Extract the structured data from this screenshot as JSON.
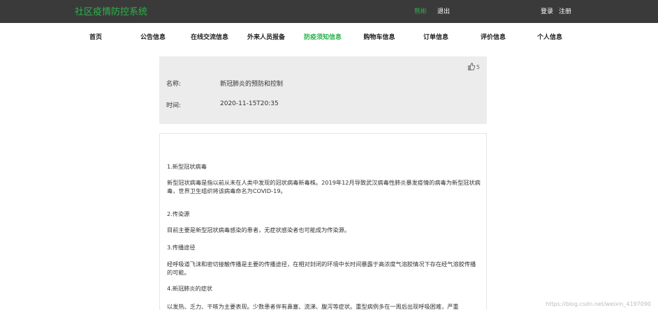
{
  "header": {
    "brand": "社区疫情防控系统",
    "links": [
      "熊彬",
      "退出",
      "登录",
      "注册"
    ]
  },
  "nav": {
    "items": [
      "首页",
      "公告信息",
      "在线交流信息",
      "外来人员报备",
      "防疫须知信息",
      "购物车信息",
      "订单信息",
      "评价信息",
      "个人信息"
    ],
    "active_index": 4
  },
  "detail": {
    "like_count": "5",
    "name_label": "名称:",
    "name_value": "新冠肺炎的预防和控制",
    "time_label": "时间:",
    "time_value": "2020-11-15T20:35"
  },
  "content": {
    "paragraphs": [
      "1.新型冠状病毒",
      "新型冠状病毒是指以前从未在人类中发现的冠状病毒新毒株。2019年12月导致武汉病毒性肺炎暴发疫情的病毒为新型冠状病毒，世界卫生组织将该病毒命名为COVID-19。",
      "2.传染源",
      "目前主要是新型冠状病毒感染的患者，无症状感染者也可能成为传染源。",
      "3.传播途径",
      "经呼吸道飞沫和密切接触传播是主要的传播途径，在相对封闭的环境中长时间暴露于高浓度气溶胶情况下存在经气溶胶传播的可能。",
      "4.新冠肺炎的症状",
      "以发热、乏力、干咳为主要表现。少数患者伴有鼻塞、流涕、腹泻等症状。重型病例多在一周后出现呼吸困难，严重"
    ]
  },
  "watermark": "https://blog.csdn.net/weixin_4197090",
  "colors": {
    "brand_green": "#2bb34a",
    "topbar_bg": "#3a3a3a",
    "panel_bg": "#ececec"
  }
}
